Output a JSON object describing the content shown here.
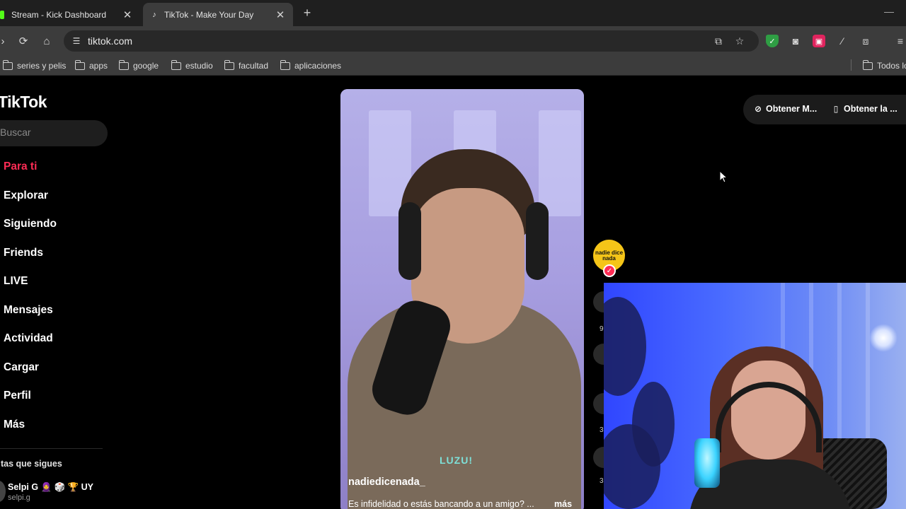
{
  "browser": {
    "tabs": [
      {
        "title": "Stream - Kick Dashboard",
        "active": false
      },
      {
        "title": "TikTok - Make Your Day",
        "active": true
      }
    ],
    "url": "tiktok.com",
    "bookmarks": [
      "series y pelis",
      "apps",
      "google",
      "estudio",
      "facultad",
      "aplicaciones"
    ],
    "all_bookmarks_label": "Todos lo"
  },
  "tiktok": {
    "logo": "TikTok",
    "search_placeholder": "Buscar",
    "nav": [
      {
        "label": "Para ti",
        "active": true
      },
      {
        "label": "Explorar"
      },
      {
        "label": "Siguiendo"
      },
      {
        "label": "Friends"
      },
      {
        "label": "LIVE"
      },
      {
        "label": "Mensajes"
      },
      {
        "label": "Actividad"
      },
      {
        "label": "Cargar"
      },
      {
        "label": "Perfil"
      },
      {
        "label": "Más"
      }
    ],
    "following_title": "tas que sigues",
    "following_account": {
      "name": "Selpi G 🧕 🎲 🏆 UY",
      "handle": "selpi.g"
    },
    "get_buttons": [
      "Obtener M...",
      "Obtener la ..."
    ],
    "video": {
      "author": "nadiedicenada_",
      "caption": "Es infidelidad o estás bancando a un amigo? ...",
      "more": "más",
      "watermark": "LUZU!"
    },
    "creator_avatar_text": "nadie dice nada",
    "side_counts": [
      "9",
      "3",
      "3"
    ]
  },
  "colors": {
    "accent": "#fe2c55",
    "page_bg": "#000000",
    "chrome_bg": "#3c3c3c",
    "tabstrip_bg": "#1f1f1f"
  }
}
